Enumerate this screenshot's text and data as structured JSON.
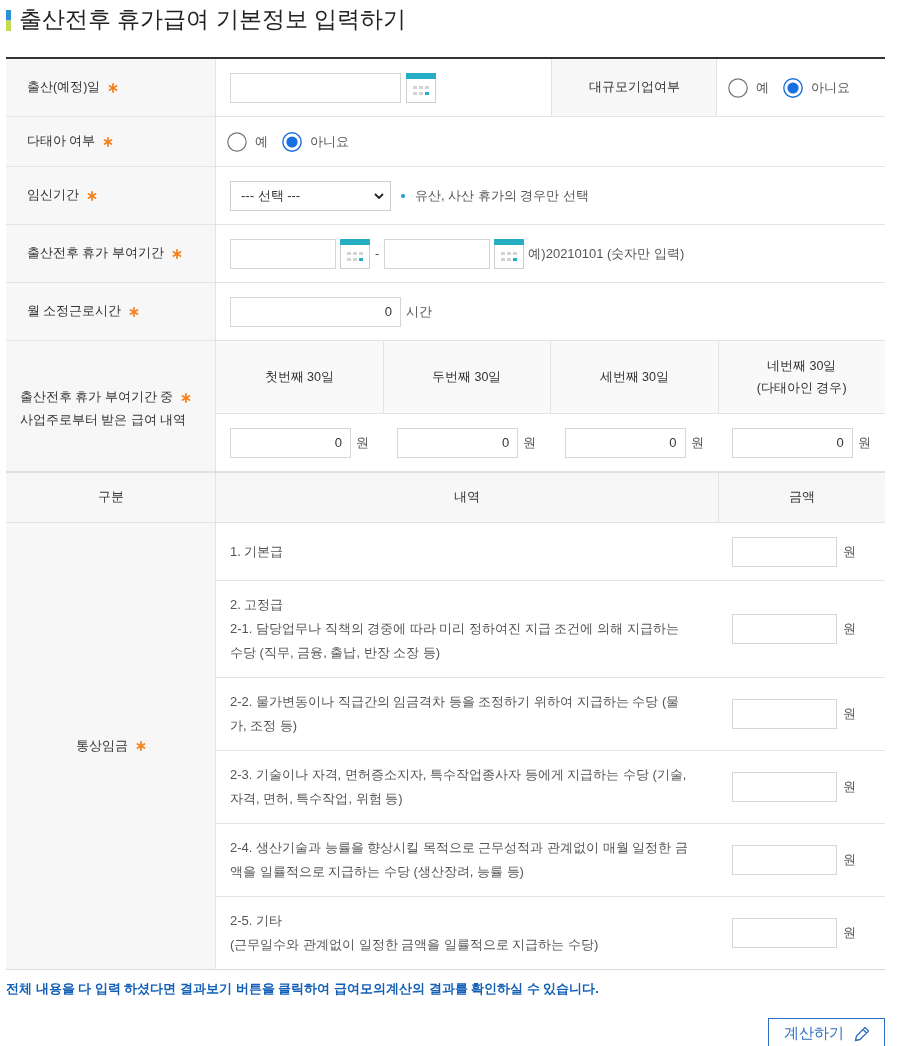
{
  "title": "출산전후 휴가급여 기본정보 입력하기",
  "basic_info": {
    "rows": [
      {
        "label": "출산(예정)일",
        "required": true,
        "fields": [
          {
            "kind": "date"
          },
          {
            "kind": "subheading",
            "text": "대규모기업여부"
          },
          {
            "kind": "radios",
            "options": [
              {
                "label": "예",
                "selected": false
              },
              {
                "label": "아니요",
                "selected": true
              }
            ]
          }
        ]
      },
      {
        "label": "다태아 여부",
        "required": true,
        "fields": [
          {
            "kind": "radios",
            "options": [
              {
                "label": "예",
                "selected": false
              },
              {
                "label": "아니요",
                "selected": true
              }
            ]
          }
        ]
      },
      {
        "label": "임신기간",
        "required": true,
        "fields": [
          {
            "kind": "select",
            "value": "--- 선택 ---"
          },
          {
            "kind": "note",
            "text": "유산, 사산 휴가의 경우만 선택"
          }
        ]
      },
      {
        "label": "출산전후 휴가 부여기간",
        "required": true,
        "fields": [
          {
            "kind": "date"
          },
          {
            "kind": "separator",
            "text": "-"
          },
          {
            "kind": "date"
          },
          {
            "kind": "hint",
            "text": "예)20210101 (숫자만 입력)"
          }
        ]
      },
      {
        "label": "월 소정근로시간",
        "required": true,
        "fields": [
          {
            "kind": "number",
            "value": "0",
            "unit": "시간"
          }
        ]
      }
    ]
  },
  "wage_history": {
    "label_lines": [
      "출산전후 휴가 부여기간 중",
      "사업주로부터 받은 급여 내역"
    ],
    "required": true,
    "columns": [
      {
        "heading": "첫번째 30일",
        "value": "0",
        "unit": "원"
      },
      {
        "heading": "두번째 30일",
        "value": "0",
        "unit": "원"
      },
      {
        "heading": "세번째 30일",
        "value": "0",
        "unit": "원"
      },
      {
        "heading": "네번째 30일\n(다태아인 경우)",
        "value": "0",
        "unit": "원"
      }
    ]
  },
  "ordinary_wage_table": {
    "columns": [
      "구분",
      "내역",
      "금액"
    ],
    "group_label": "통상임금",
    "required": true,
    "items": [
      {
        "text": "1. 기본급",
        "unit": "원"
      },
      {
        "text": "2. 고정급\n2-1. 담당업무나 직책의 경중에 따라 미리 정하여진 지급 조건에 의해 지급하는 수당 (직무, 금융, 출납, 반장 소장 등)",
        "unit": "원"
      },
      {
        "text": "2-2. 물가변동이나 직급간의 임금격차 등을 조정하기 위하여 지급하는 수당 (물가, 조정 등)",
        "unit": "원"
      },
      {
        "text": "2-3. 기술이나 자격, 면허증소지자, 특수작업종사자 등에게 지급하는 수당 (기술, 자격, 면허, 특수작업, 위험 등)",
        "unit": "원"
      },
      {
        "text": "2-4. 생산기술과 능률을 향상시킬 목적으로 근무성적과 관계없이 매월 일정한 금액을 일률적으로 지급하는 수당 (생산장려, 능률 등)",
        "unit": "원"
      },
      {
        "text": "2-5. 기타\n(근무일수와 관계없이 일정한 금액을 일률적으로 지급하는 수당)",
        "unit": "원"
      }
    ]
  },
  "notice": "전체 내용을 다 입력 하셨다면 결과보기 버튼을 클릭하여 급여모의계산의 결과를 확인하실 수 있습니다.",
  "calculate_button": "계산하기"
}
